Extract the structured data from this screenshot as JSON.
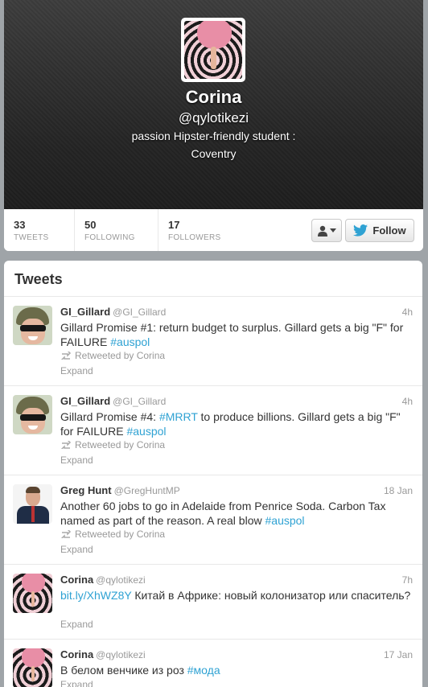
{
  "profile": {
    "name": "Corina",
    "screen_name": "@qylotikezi",
    "bio": "passion Hipster-friendly student :",
    "location": "Coventry"
  },
  "stats": [
    {
      "num": "33",
      "label": "TWEETS"
    },
    {
      "num": "50",
      "label": "FOLLOWING"
    },
    {
      "num": "17",
      "label": "FOLLOWERS"
    }
  ],
  "actions": {
    "follow_label": "Follow",
    "user_menu_icon": "person-dropdown-icon"
  },
  "tweets_section": {
    "title": "Tweets"
  },
  "tweets": [
    {
      "name": "GI_Gillard",
      "handle": "@GI_Gillard",
      "time": "4h",
      "text_parts": [
        "Gillard Promise #1: return budget to surplus. Gillard gets a big \"F\" for FAILURE ",
        "#auspol"
      ],
      "retweet": "Retweeted by Corina",
      "expand": "Expand"
    },
    {
      "name": "GI_Gillard",
      "handle": "@GI_Gillard",
      "time": "4h",
      "text_parts": [
        "Gillard Promise #4: ",
        "#MRRT",
        " to produce billions. Gillard gets a big \"F\" for FAILURE ",
        "#auspol"
      ],
      "retweet": "Retweeted by Corina",
      "expand": "Expand"
    },
    {
      "name": "Greg Hunt",
      "handle": "@GregHuntMP",
      "time": "18 Jan",
      "text_parts": [
        "Another 60 jobs to go in Adelaide from Penrice Soda. Carbon Tax named as part of the reason. A real blow ",
        "#auspol"
      ],
      "retweet": "Retweeted by Corina",
      "expand": "Expand"
    },
    {
      "name": "Corina",
      "handle": "@qylotikezi",
      "time": "7h",
      "text_parts": [
        "bit.ly/XhWZ8Y",
        " Китай в Африке: новый колонизатор или спаситель?"
      ],
      "expand": "Expand"
    },
    {
      "name": "Corina",
      "handle": "@qylotikezi",
      "time": "17 Jan",
      "text_parts": [
        "В белом венчике из роз ",
        "#мода"
      ],
      "expand": "Expand"
    }
  ],
  "colors": {
    "link": "#2fa2d3",
    "twitter_bird": "#2fa2d3"
  }
}
